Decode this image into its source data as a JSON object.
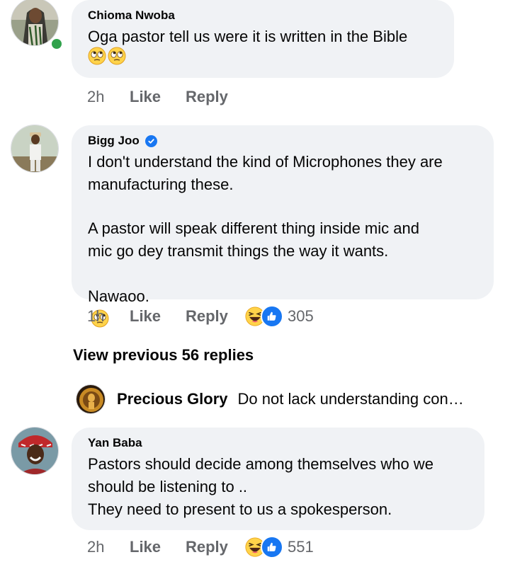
{
  "colors": {
    "bubble": "#f0f2f5",
    "meta": "#65676b",
    "online": "#31a24c",
    "like_blue": "#1877f2"
  },
  "comments": [
    {
      "author": "Chioma Nwoba",
      "verified": false,
      "online": true,
      "text": "Oga pastor tell us were it is written in the Bible",
      "emojis": [
        "eye-roll-emoji",
        "eye-roll-emoji"
      ],
      "time": "2h",
      "like_label": "Like",
      "reply_label": "Reply"
    },
    {
      "author": "Bigg Joo",
      "verified": true,
      "text_p1": "I don't understand the kind of Microphones they are\nmanufacturing these.",
      "text_p2": "A pastor will speak different thing inside mic and\nmic go dey transmit things the way it wants.",
      "text_p3": "Nawaoo.",
      "emojis": [
        "eye-roll-emoji"
      ],
      "time": "1h",
      "like_label": "Like",
      "reply_label": "Reply",
      "reaction_count": "305"
    },
    {
      "author": "Yan Baba",
      "verified": false,
      "text": "Pastors should decide among themselves who we\nshould be listening to ..\nThey need to present to us a spokesperson.",
      "time": "2h",
      "like_label": "Like",
      "reply_label": "Reply",
      "reaction_count": "551"
    }
  ],
  "view_previous": "View previous 56 replies",
  "reply_preview": {
    "author": "Precious Glory",
    "text": "Do not lack understanding con…"
  }
}
